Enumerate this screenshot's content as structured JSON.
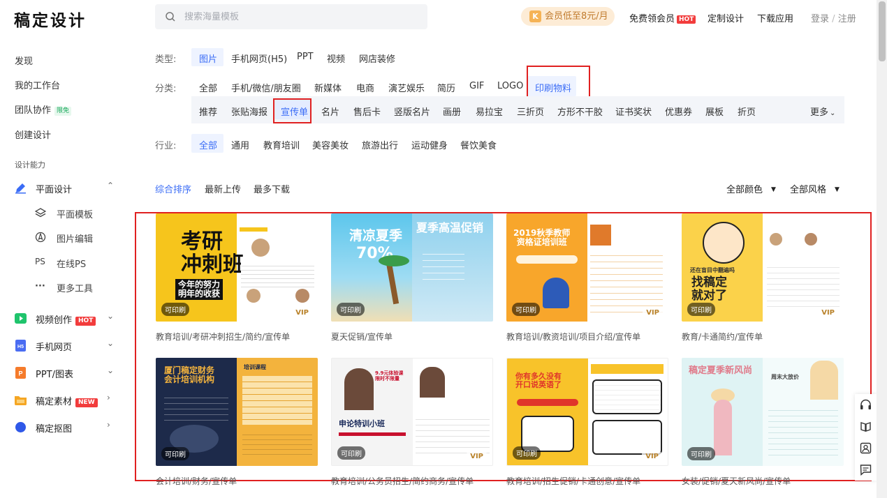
{
  "header": {
    "logo": "稿定设计",
    "search_placeholder": "搜索海量模板",
    "vip_promo": "会员低至8元/月",
    "nav": [
      {
        "label": "免费领会员",
        "badge": "HOT"
      },
      {
        "label": "定制设计"
      },
      {
        "label": "下载应用"
      }
    ],
    "login": "登录",
    "login_sep": "/",
    "register": "注册"
  },
  "sidebar": {
    "links": [
      {
        "label": "发现"
      },
      {
        "label": "我的工作台"
      },
      {
        "label": "团队协作",
        "tag": "限免"
      },
      {
        "label": "创建设计"
      }
    ],
    "section_title": "设计能力",
    "groups": [
      {
        "label": "平面设计",
        "icon": "pen-icon",
        "color": "#3a6cf6",
        "chevron": "⌃"
      },
      {
        "label": "视频创作",
        "icon": "video-icon",
        "color": "#1fc46c",
        "badge": "HOT",
        "chevron": "⌄"
      },
      {
        "label": "手机网页",
        "icon": "h5-icon",
        "color": "#4a6cf2",
        "chevron": "⌄"
      },
      {
        "label": "PPT/图表",
        "icon": "ppt-icon",
        "color": "#f57b2b",
        "chevron": "⌄"
      },
      {
        "label": "稿定素材",
        "icon": "folder-icon",
        "color": "#f5a623",
        "badge": "NEW",
        "chevron": "›"
      },
      {
        "label": "稿定抠图",
        "icon": "cutout-icon",
        "color": "#2f58e8",
        "chevron": "›"
      }
    ],
    "sub_items": [
      {
        "label": "平面模板",
        "icon": "layers-icon"
      },
      {
        "label": "图片编辑",
        "icon": "compass-icon"
      },
      {
        "label": "在线PS",
        "icon": "ps-icon",
        "glyph": "PS"
      },
      {
        "label": "更多工具",
        "icon": "more-icon",
        "glyph": "···"
      }
    ]
  },
  "filters": {
    "type_label": "类型:",
    "types": [
      "图片",
      "手机网页(H5)",
      "PPT",
      "视频",
      "网店装修"
    ],
    "category_label": "分类:",
    "categories": [
      "全部",
      "手机/微信/朋友圈",
      "新媒体",
      "电商",
      "演艺娱乐",
      "简历",
      "GIF",
      "LOGO",
      "印刷物料"
    ],
    "subcategories": [
      "推荐",
      "张贴海报",
      "宣传单",
      "名片",
      "售后卡",
      "竖版名片",
      "画册",
      "易拉宝",
      "三折页",
      "方形不干胶",
      "证书奖状",
      "优惠券",
      "展板",
      "折页"
    ],
    "more": "更多",
    "industry_label": "行业:",
    "industries": [
      "全部",
      "通用",
      "教育培训",
      "美容美妆",
      "旅游出行",
      "运动健身",
      "餐饮美食"
    ]
  },
  "sort": {
    "options": [
      "综合排序",
      "最新上传",
      "最多下载"
    ],
    "color_filter": "全部颜色",
    "style_filter": "全部风格"
  },
  "templates": [
    {
      "caption": "教育培训/考研冲刺招生/简约/宣传单",
      "print": "可印刷",
      "vip": "VIP",
      "title": "考研\n冲刺班",
      "sub": "今年的努力\n明年的收获",
      "bg1": "#f6c51c",
      "bg2": "#ffffff"
    },
    {
      "caption": "夏天促销/宣传单",
      "print": "可印刷",
      "vip": "",
      "title": "清凉夏季",
      "sub": "70%",
      "side_title": "夏季高温促销",
      "bg1": "#5cc6ec",
      "bg2": "#a7d8ef"
    },
    {
      "caption": "教育培训/教资培训/项目介绍/宣传单",
      "print": "可印刷",
      "vip": "VIP",
      "title": "2019秋季教师\n资格证培训班",
      "bg1": "#f8a62b",
      "bg2": "#ffffff"
    },
    {
      "caption": "教育/卡通简约/宣传单",
      "print": "可印刷",
      "vip": "VIP",
      "title": "找稿定\n就对了",
      "sub": "还在盲目中翻遍吗",
      "bg1": "#fbd24a",
      "bg2": "#ffffff"
    },
    {
      "caption": "会计培训/财务/宣传单",
      "print": "可印刷",
      "vip": "",
      "title": "厦门稿定财务\n会计培训机构",
      "sub": "培训课程",
      "bg1": "#1d2a4a",
      "bg2": "#f3b33d"
    },
    {
      "caption": "教育培训/公务员招生/简约商务/宣传单",
      "print": "可印刷",
      "vip": "VIP",
      "title": "申论特训小班",
      "sub": "9.9元体验课\n限时不限量",
      "bg1": "#f4f4f4",
      "bg2": "#ffffff"
    },
    {
      "caption": "教育培训/招生促销/卡通创意/宣传单",
      "print": "可印刷",
      "vip": "VIP",
      "title": "你有多久没有\n开口说英语了",
      "bg1": "#f8c32a",
      "bg2": "#ffffff"
    },
    {
      "caption": "女装/促销/夏天新风尚/宣传单",
      "print": "可印刷",
      "vip": "",
      "title": "稿定夏季新风尚",
      "sub": "周末大放价",
      "bg1": "#dff3f4",
      "bg2": "#f3fbfb"
    }
  ]
}
